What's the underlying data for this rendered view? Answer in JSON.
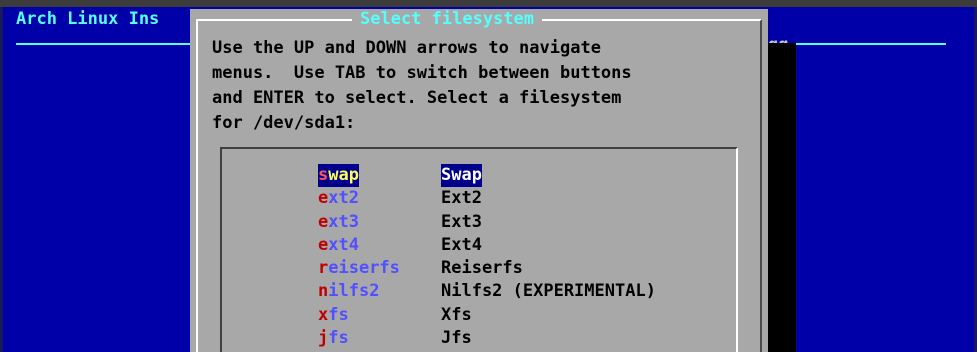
{
  "backtitle": "Arch Linux Ins",
  "background_fragment": "qq",
  "dialog": {
    "title": "Select filesystem",
    "text_lines": [
      "Use the UP and DOWN arrows to navigate",
      "menus.  Use TAB to switch between buttons",
      "and ENTER to select. Select a filesystem",
      "for /dev/sda1:"
    ]
  },
  "menu": {
    "selected_index": 0,
    "items": [
      {
        "tag_hot": "s",
        "tag_rest": "wap",
        "label": "Swap"
      },
      {
        "tag_hot": "e",
        "tag_rest": "xt2",
        "label": "Ext2"
      },
      {
        "tag_hot": "e",
        "tag_rest": "xt3",
        "label": "Ext3"
      },
      {
        "tag_hot": "e",
        "tag_rest": "xt4",
        "label": "Ext4"
      },
      {
        "tag_hot": "r",
        "tag_rest": "eiserfs",
        "label": "Reiserfs"
      },
      {
        "tag_hot": "n",
        "tag_rest": "ilfs2",
        "label": "Nilfs2 (EXPERIMENTAL)"
      },
      {
        "tag_hot": "x",
        "tag_rest": "fs",
        "label": "Xfs"
      },
      {
        "tag_hot": "j",
        "tag_rest": "fs",
        "label": "Jfs"
      }
    ]
  },
  "colors": {
    "background_blue": "#0000a8",
    "dialog_gray": "#a8a8a8",
    "title_cyan": "#55ffff",
    "hotkey_red": "#c00000",
    "tag_blue": "#5050ff",
    "selection_bg": "#00008c",
    "selection_fg": "#ffff55"
  }
}
